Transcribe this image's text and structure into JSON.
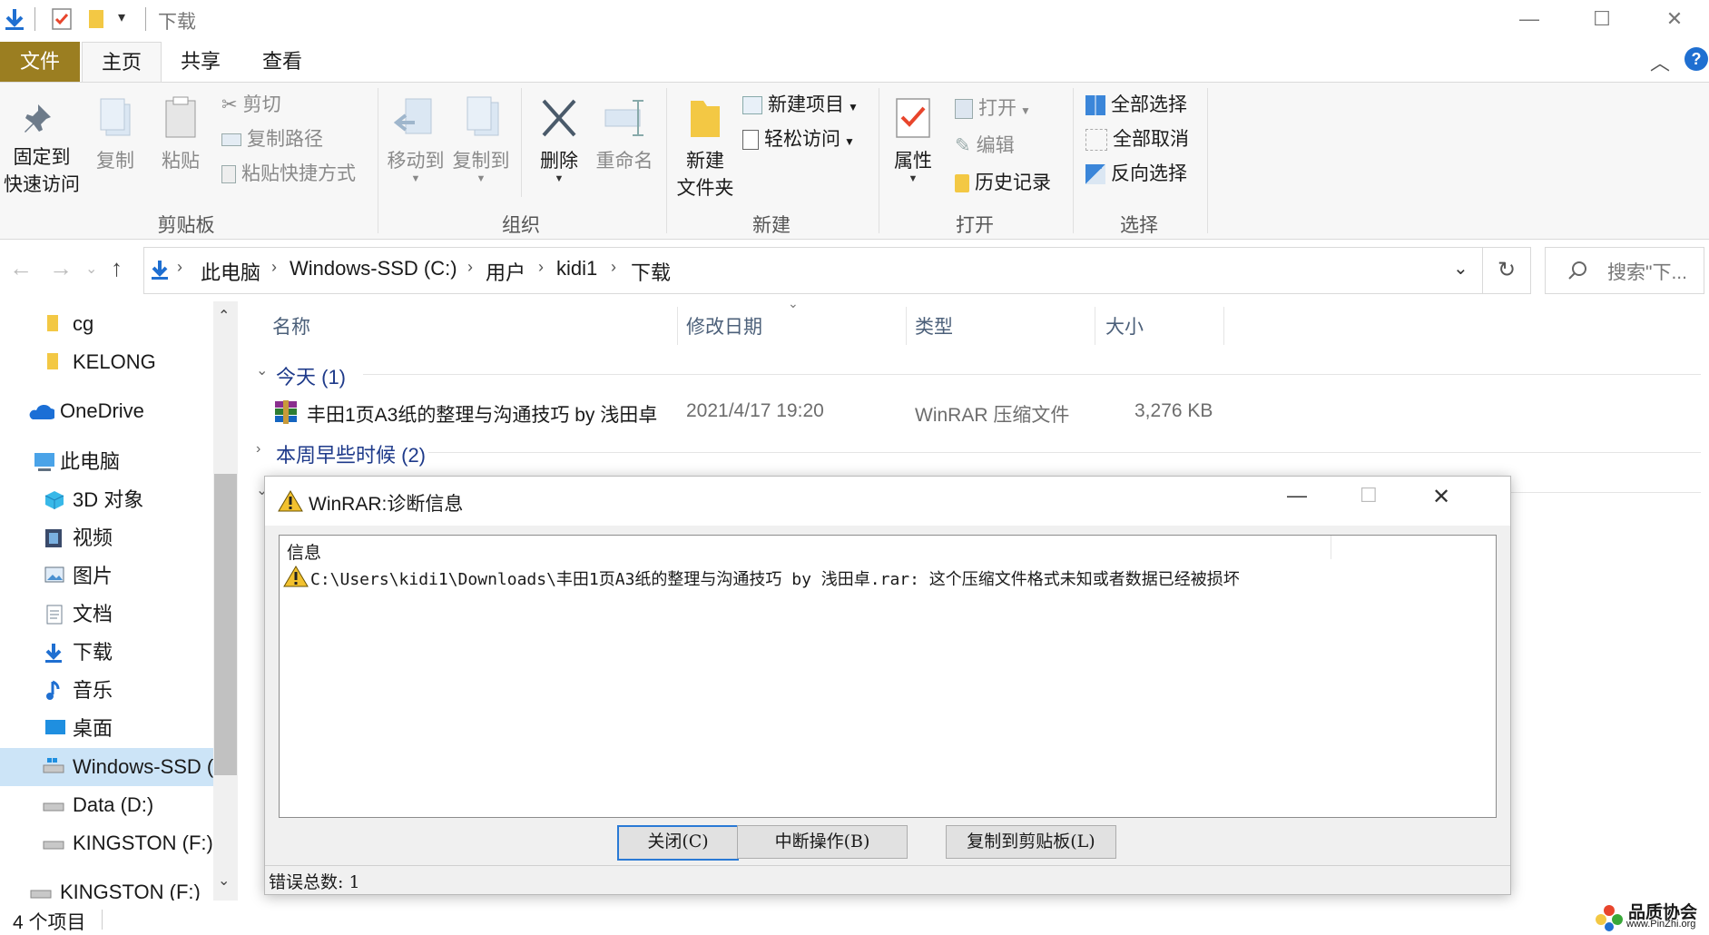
{
  "window": {
    "title": "下载",
    "controls": {
      "minimize": "—",
      "maximize": "☐",
      "close": "✕"
    }
  },
  "ribbon_tabs": [
    {
      "label": "文件"
    },
    {
      "label": "主页"
    },
    {
      "label": "共享"
    },
    {
      "label": "查看"
    }
  ],
  "ribbon": {
    "clipboard": {
      "pin_line1": "固定到",
      "pin_line2": "快速访问",
      "copy": "复制",
      "paste": "粘贴",
      "cut": "剪切",
      "copy_path": "复制路径",
      "paste_shortcut": "粘贴快捷方式",
      "label": "剪贴板"
    },
    "organize": {
      "move_to": "移动到",
      "copy_to": "复制到",
      "delete": "删除",
      "rename": "重命名",
      "label": "组织"
    },
    "new": {
      "new_folder_line1": "新建",
      "new_folder_line2": "文件夹",
      "new_item": "新建项目",
      "easy_access": "轻松访问",
      "label": "新建"
    },
    "open": {
      "properties": "属性",
      "open": "打开",
      "edit": "编辑",
      "history": "历史记录",
      "label": "打开"
    },
    "select": {
      "select_all": "全部选择",
      "select_none": "全部取消",
      "invert": "反向选择",
      "label": "选择"
    }
  },
  "address": {
    "crumbs": [
      "此电脑",
      "Windows-SSD (C:)",
      "用户",
      "kidi1",
      "下载"
    ],
    "search_placeholder": "搜索\"下..."
  },
  "nav_pane": {
    "items": [
      {
        "label": "cg",
        "icon": "folder-icon"
      },
      {
        "label": "KELONG",
        "icon": "folder-icon"
      },
      {
        "label": "OneDrive",
        "icon": "cloud-icon"
      },
      {
        "label": "此电脑",
        "icon": "computer-icon"
      },
      {
        "label": "3D 对象",
        "icon": "cube-icon"
      },
      {
        "label": "视频",
        "icon": "video-icon"
      },
      {
        "label": "图片",
        "icon": "picture-icon"
      },
      {
        "label": "文档",
        "icon": "document-icon"
      },
      {
        "label": "下载",
        "icon": "download-icon"
      },
      {
        "label": "音乐",
        "icon": "music-icon"
      },
      {
        "label": "桌面",
        "icon": "desktop-icon"
      },
      {
        "label": "Windows-SSD (C:)",
        "icon": "drive-icon"
      },
      {
        "label": "Data (D:)",
        "icon": "drive-icon"
      },
      {
        "label": "KINGSTON (F:)",
        "icon": "drive-icon"
      },
      {
        "label": "KINGSTON (F:)",
        "icon": "drive-icon"
      }
    ]
  },
  "file_list": {
    "columns": [
      "名称",
      "修改日期",
      "类型",
      "大小"
    ],
    "group_today": "今天 (1)",
    "group_week": "本周早些时候 (2)",
    "files": [
      {
        "name": "丰田1页A3纸的整理与沟通技巧 by 浅田卓",
        "date": "2021/4/17 19:20",
        "type": "WinRAR 压缩文件",
        "size": "3,276 KB"
      }
    ]
  },
  "dialog": {
    "title": "WinRAR:诊断信息",
    "column_header": "信息",
    "message": "C:\\Users\\kidi1\\Downloads\\丰田1页A3纸的整理与沟通技巧 by 浅田卓.rar: 这个压缩文件格式未知或者数据已经被损坏",
    "buttons": {
      "close": "关闭(C)",
      "break": "中断操作(B)",
      "copy": "复制到剪贴板(L)"
    },
    "error_count": "错误总数: 1"
  },
  "status": {
    "item_count": "4 个项目"
  },
  "watermark": {
    "brand": "品质协会",
    "url": "www.PinZhi.org"
  }
}
